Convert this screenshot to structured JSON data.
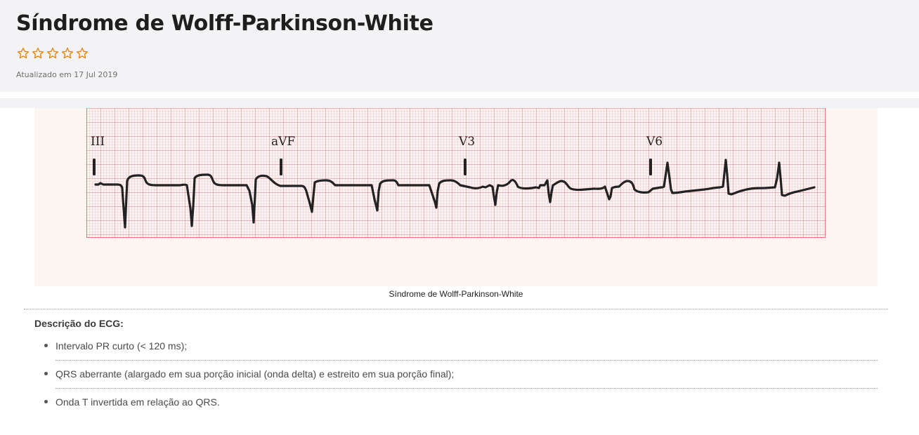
{
  "header": {
    "title": "Síndrome de Wolff-Parkinson-White",
    "rating": {
      "value": 0,
      "max": 5
    },
    "updated": "Atualizado em 17 Jul 2019"
  },
  "figure": {
    "leads": [
      "III",
      "aVF",
      "V3",
      "V6"
    ],
    "caption": "Síndrome de Wolff-Parkinson-White",
    "colors": {
      "background": "#fcf6f3",
      "grid": "#e4737b",
      "trace": "#222222"
    }
  },
  "description": {
    "title": "Descrição do ECG:",
    "items": [
      "Intervalo PR curto (< 120 ms);",
      "QRS aberrante (alargado em sua porção inicial (onda delta) e estreito em sua porção final);",
      "Onda T invertida em relação ao QRS."
    ]
  }
}
